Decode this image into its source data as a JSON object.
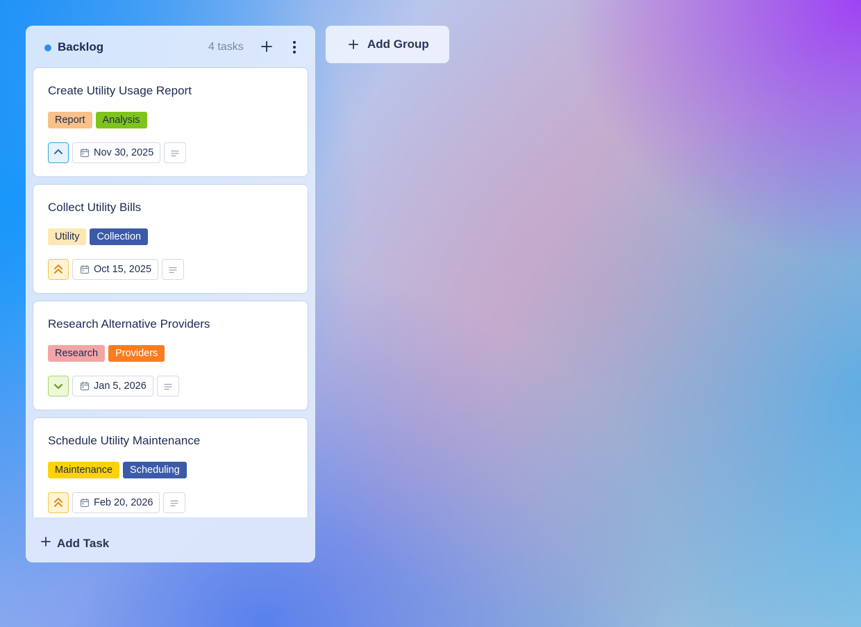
{
  "column": {
    "title": "Backlog",
    "task_count": "4 tasks",
    "dot_color": "#2f8ce8",
    "add_icon": "plus-icon",
    "more_icon": "more-vertical-icon",
    "add_task_label": "Add Task"
  },
  "add_group": {
    "label": "Add Group",
    "icon": "plus-icon"
  },
  "cards": [
    {
      "title": "Create Utility Usage Report",
      "tags": [
        {
          "label": "Report",
          "bg": "#f9c089",
          "fg": "#1c2a52"
        },
        {
          "label": "Analysis",
          "bg": "#7fc41d",
          "fg": "#1c2a52"
        }
      ],
      "priority": "low",
      "priority_icon": "chevron-up-icon",
      "date": "Nov 30, 2025",
      "date_icon": "calendar-icon",
      "desc_icon": "description-icon"
    },
    {
      "title": "Collect Utility Bills",
      "tags": [
        {
          "label": "Utility",
          "bg": "#fde7b5",
          "fg": "#1c2a52"
        },
        {
          "label": "Collection",
          "bg": "#3c5aa8",
          "fg": "#ffffff"
        }
      ],
      "priority": "high",
      "priority_icon": "double-chevron-up-icon",
      "date": "Oct 15, 2025",
      "date_icon": "calendar-icon",
      "desc_icon": "description-icon"
    },
    {
      "title": "Research Alternative Providers",
      "tags": [
        {
          "label": "Research",
          "bg": "#f2a5a5",
          "fg": "#1c2a52"
        },
        {
          "label": "Providers",
          "bg": "#fb7c1f",
          "fg": "#ffffff"
        }
      ],
      "priority": "lowest",
      "priority_icon": "chevron-down-icon",
      "date": "Jan 5, 2026",
      "date_icon": "calendar-icon",
      "desc_icon": "description-icon"
    },
    {
      "title": "Schedule Utility Maintenance",
      "tags": [
        {
          "label": "Maintenance",
          "bg": "#fdd20a",
          "fg": "#1c2a52"
        },
        {
          "label": "Scheduling",
          "bg": "#3c5aa8",
          "fg": "#ffffff"
        }
      ],
      "priority": "high",
      "priority_icon": "double-chevron-up-icon",
      "date": "Feb 20, 2026",
      "date_icon": "calendar-icon",
      "desc_icon": "description-icon"
    }
  ]
}
